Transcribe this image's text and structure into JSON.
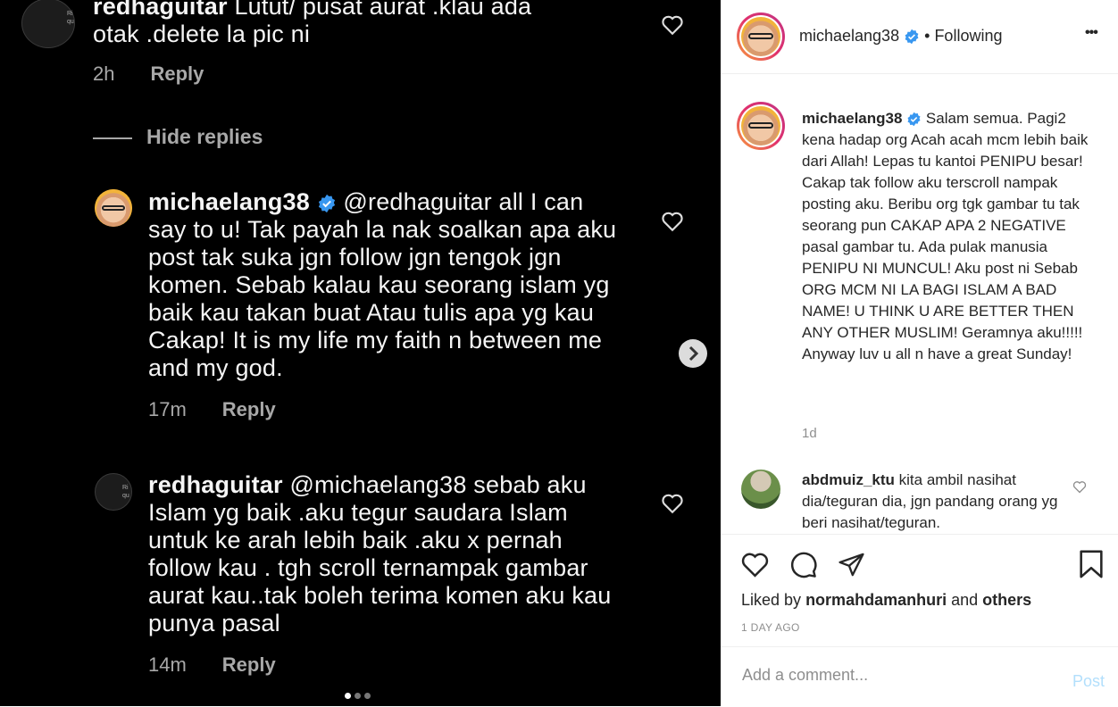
{
  "media": {
    "comments": [
      {
        "user": "redhaguitar",
        "text_line1": "Lutut/ pusat aurat .klau ada",
        "text_line2": "otak .delete la pic ni",
        "time": "2h",
        "reply": "Reply"
      },
      {
        "hide_replies": "Hide replies"
      },
      {
        "user": "michaelang38",
        "mention": "@redhaguitar",
        "lines": [
          "all I can",
          "say to u! Tak payah la nak soalkan apa aku",
          "post tak suka jgn follow jgn tengok jgn",
          "komen. Sebab kalau kau seorang islam yg",
          "baik kau takan buat Atau tulis apa yg kau",
          "Cakap! It is my life my faith n between me",
          "and my god."
        ],
        "time": "17m",
        "reply": "Reply"
      },
      {
        "user": "redhaguitar",
        "mention": "@michaelang38",
        "lines": [
          "sebab aku",
          "Islam yg baik .aku tegur saudara Islam",
          "untuk ke arah lebih baik .aku x pernah",
          "follow kau . tgh scroll ternampak gambar",
          "aurat kau..tak boleh terima komen aku kau",
          "punya pasal"
        ],
        "time": "14m",
        "reply": "Reply"
      }
    ],
    "avatar_dark_text": "Ri qu",
    "carousel": {
      "count": 3,
      "active": 0
    }
  },
  "sidebar": {
    "header": {
      "username": "michaelang38",
      "separator": "•",
      "following": "Following",
      "more": "•••"
    },
    "caption": {
      "username": "michaelang38",
      "text": "Salam semua. Pagi2 kena hadap org Acah acah mcm lebih baik dari Allah! Lepas tu kantoi PENIPU besar! Cakap tak follow aku terscroll nampak posting aku. Beribu org tgk gambar tu tak seorang pun CAKAP APA 2 NEGATIVE pasal gambar tu. Ada pulak manusia PENIPU NI MUNCUL! Aku post ni Sebab ORG MCM NI LA BAGI ISLAM A BAD NAME! U THINK U ARE BETTER THEN ANY OTHER MUSLIM! Geramnya aku!!!!! Anyway luv u all n have a great Sunday!",
      "time": "1d"
    },
    "comment": {
      "username": "abdmuiz_ktu",
      "text": "kita ambil nasihat dia/teguran dia, jgn pandang orang yg beri nasihat/teguran."
    },
    "likes": {
      "prefix": "Liked by",
      "user": "normahdamanhuri",
      "and": "and",
      "others": "others"
    },
    "date": "1 DAY AGO",
    "add_comment": {
      "placeholder": "Add a comment...",
      "post": "Post"
    },
    "colors": {
      "verified": "#3897f0",
      "post_disabled": "#b2dffc"
    }
  }
}
